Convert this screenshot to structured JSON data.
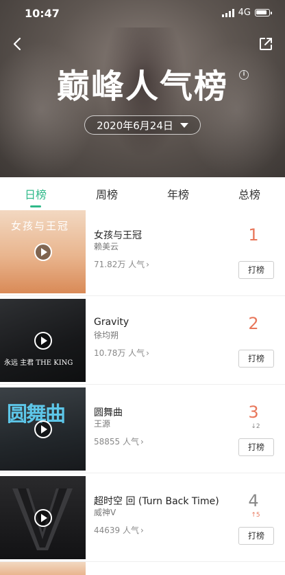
{
  "status_bar": {
    "time": "10:47",
    "network": "4G"
  },
  "header": {
    "title": "巅峰人气榜",
    "info_icon": "info-icon",
    "date": "2020年6月24日"
  },
  "tabs": [
    {
      "label": "日榜",
      "active": true
    },
    {
      "label": "周榜",
      "active": false
    },
    {
      "label": "年榜",
      "active": false
    },
    {
      "label": "总榜",
      "active": false
    }
  ],
  "songs": [
    {
      "title": "女孩与王冠",
      "artist": "赖美云",
      "popularity": "71.82万 人气",
      "rank": "1",
      "change": "",
      "vote_label": "打榜",
      "cover_text": "女孩与王冠"
    },
    {
      "title": "Gravity",
      "artist": "徐均朔",
      "popularity": "10.78万 人气",
      "rank": "2",
      "change": "",
      "vote_label": "打榜",
      "cover_text": "永远 主君 THE KING"
    },
    {
      "title": "圆舞曲",
      "artist": "王源",
      "popularity": "58855 人气",
      "rank": "3",
      "change": "↓2",
      "vote_label": "打榜",
      "cover_text": "圆舞曲"
    },
    {
      "title": "超时空 回 (Turn Back Time)",
      "artist": "威神V",
      "popularity": "44639 人气",
      "rank": "4",
      "change": "↑5",
      "vote_label": "打榜",
      "cover_text": ""
    }
  ],
  "colors": {
    "accent": "#2fb989",
    "rank_hot": "#e8765a"
  }
}
